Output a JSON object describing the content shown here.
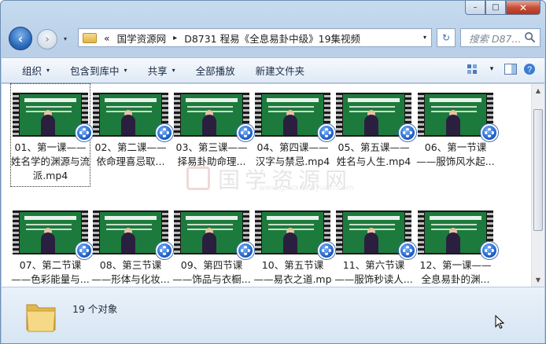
{
  "window": {
    "minimize": "–",
    "maximize": "□",
    "close": "✕"
  },
  "address": {
    "back_icon": "‹",
    "forward_icon": "›",
    "nav_dropdown": "▾",
    "prefix": "«",
    "segments": [
      "国学资源网",
      "D8731 程易《全息易卦中级》19集视频"
    ],
    "separator": "▸",
    "dropdown": "▾",
    "refresh": "↻"
  },
  "search": {
    "placeholder": "搜索 D87..."
  },
  "toolbar": {
    "organize": "组织",
    "include_library": "包含到库中",
    "share": "共享",
    "play_all": "全部播放",
    "new_folder": "新建文件夹",
    "arrow": "▾"
  },
  "items": [
    {
      "label": "01、第一课——姓名学的渊源与流派.mp4",
      "title": "全息易卦与姓名"
    },
    {
      "label": "02、第二课——依命理喜忌取...",
      "title": "全息易卦与姓名"
    },
    {
      "label": "03、第三课——择易卦助命理...",
      "title": "第三课 择易卦助命理"
    },
    {
      "label": "04、第四课——汉字与禁忌.mp4",
      "title": "汉字的由来"
    },
    {
      "label": "05、第五课——姓名与人生.mp4",
      "title": "全息易卦与姓名"
    },
    {
      "label": "06、第一节课——服饰风水起...",
      "title": "全息易卦与服饰"
    },
    {
      "label": "07、第二节课——色彩能量与...",
      "title": "全息易卦与服饰"
    },
    {
      "label": "08、第三节课——形体与化妆...",
      "title": "全息易卦与服饰"
    },
    {
      "label": "09、第四节课——饰品与衣橱...",
      "title": "美丽的饰品"
    },
    {
      "label": "10、第五节课——易衣之道.mp4",
      "title": "不穿错衣一辈更好"
    },
    {
      "label": "11、第六节课——服饰秒读人...",
      "title": "全息易卦与服饰"
    },
    {
      "label": "12、第一课——全息易卦的渊...",
      "title": "全息易卦与风水"
    }
  ],
  "status": {
    "count": "19 个对象"
  },
  "colors": {
    "accent": "#2d6bbd",
    "thumb_green": "#1d7a3d",
    "close_red": "#c75038"
  }
}
